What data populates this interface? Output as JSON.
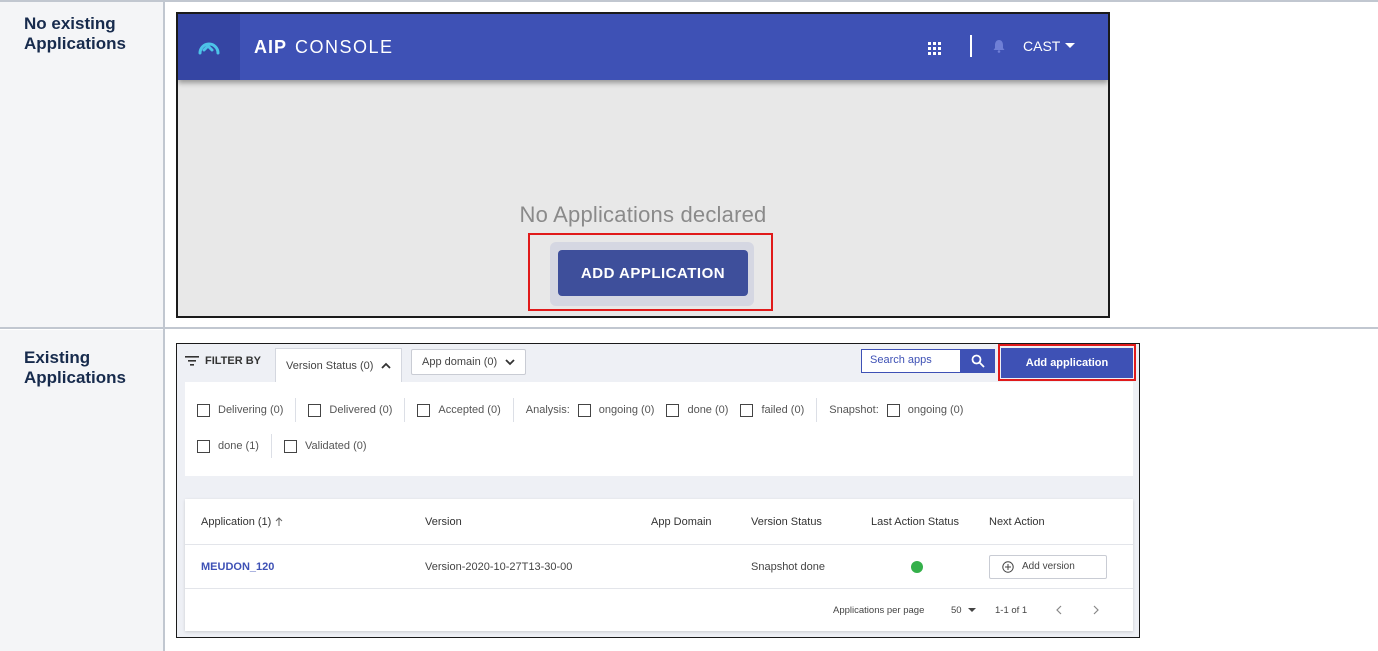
{
  "rows": [
    {
      "label": "No existing Applications"
    },
    {
      "label": "Existing Applications"
    }
  ],
  "console": {
    "brand_bold": "AIP",
    "brand_light": "CONSOLE",
    "user": "CAST",
    "empty_message": "No Applications declared",
    "add_button": "ADD APPLICATION",
    "colors": {
      "topbar": "#3e51b5",
      "button": "#3e4f9b",
      "highlight": "#e01a1a"
    }
  },
  "list": {
    "filter_by": "FILTER BY",
    "tabs": [
      {
        "label": "Version Status (0)",
        "chevron": "up"
      },
      {
        "label": "App domain (0)",
        "chevron": "down"
      }
    ],
    "search_placeholder": "Search apps",
    "add_button": "Add application",
    "filters_row1": [
      {
        "label": "Delivering (0)"
      },
      {
        "label": "Delivered (0)"
      },
      {
        "label": "Accepted (0)"
      }
    ],
    "analysis_label": "Analysis:",
    "analysis_filters": [
      {
        "label": "ongoing (0)"
      },
      {
        "label": "done (0)"
      },
      {
        "label": "failed (0)"
      }
    ],
    "snapshot_label": "Snapshot:",
    "snapshot_filter_ongoing": "ongoing (0)",
    "filters_row2": [
      {
        "label": "done (1)"
      },
      {
        "label": "Validated (0)"
      }
    ],
    "columns": {
      "application": "Application (1)",
      "version": "Version",
      "app_domain": "App Domain",
      "version_status": "Version Status",
      "last_action_status": "Last Action Status",
      "next_action": "Next Action"
    },
    "table_rows": [
      {
        "application": "MEUDON_120",
        "version": "Version-2020-10-27T13-30-00",
        "app_domain": "",
        "version_status": "Snapshot done",
        "last_action_status": "success",
        "next_action": "Add version"
      }
    ],
    "pagination": {
      "per_page_label": "Applications per page",
      "per_page_value": "50",
      "range": "1-1 of 1"
    }
  }
}
